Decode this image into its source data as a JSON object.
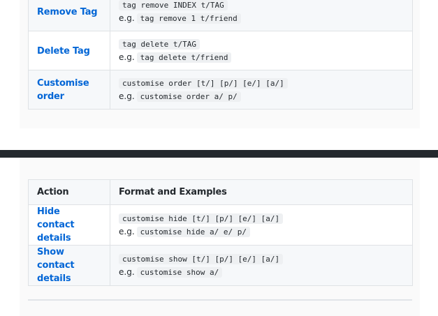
{
  "top_table": {
    "rows": [
      {
        "action": "Remove Tag",
        "format": "tag remove INDEX t/TAG",
        "eg_label": "e.g.",
        "example": "tag remove 1 t/friend"
      },
      {
        "action": "Delete Tag",
        "format": "tag delete t/TAG",
        "eg_label": "e.g.",
        "example": "tag delete t/friend"
      },
      {
        "action": "Customise order",
        "format": "customise order [t/] [p/] [e/] [a/]",
        "eg_label": "e.g.",
        "example": "customise order a/ p/"
      }
    ]
  },
  "bottom_table": {
    "headers": {
      "action": "Action",
      "format": "Format and Examples"
    },
    "rows": [
      {
        "action": "Hide contact details",
        "format": "customise hide [t/] [p/] [e/] [a/]",
        "eg_label": "e.g.",
        "example": "customise hide a/ e/ p/"
      },
      {
        "action": "Show contact details",
        "format": "customise show [t/] [p/] [e/] [a/]",
        "eg_label": "e.g.",
        "example": "customise show a/"
      }
    ]
  },
  "colors": {
    "link": "#0366d6",
    "dark_bar": "#24292e",
    "row_alt": "#f6f8fa",
    "border": "#dfe2e5"
  }
}
